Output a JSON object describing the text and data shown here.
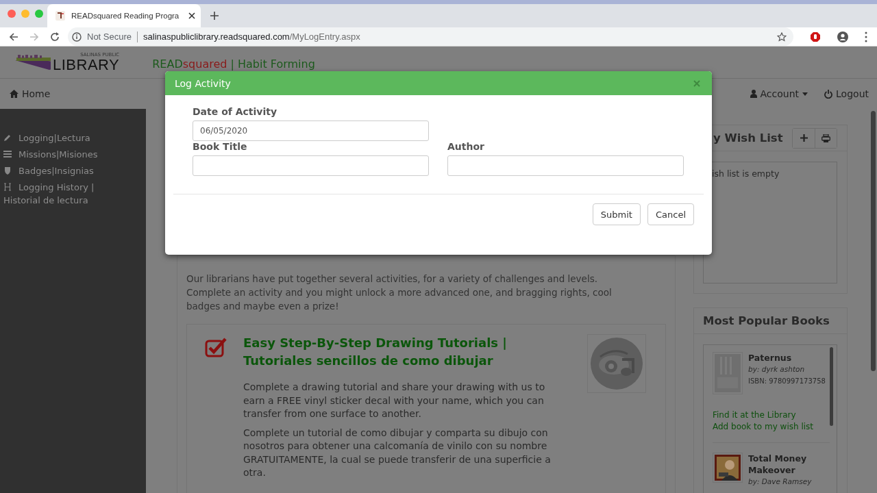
{
  "browser": {
    "tab_title": "READsquared Reading Progra",
    "security": "Not Secure",
    "url_host": "salinaspubliclibrary.readsquared.com",
    "url_path": "/MyLogEntry.aspx"
  },
  "header": {
    "logo_small": "SALINAS PUBLIC",
    "logo_big": "LIBRARY",
    "brand": [
      {
        "text": "READ",
        "color": "#1c5a1c"
      },
      {
        "text": "squared",
        "color": "#8a1a1a"
      },
      {
        "text": " | Habit Forming",
        "color": "#1c5a1c"
      }
    ]
  },
  "nav": {
    "home": "Home",
    "account": "Account",
    "logout": "Logout"
  },
  "sidebar": {
    "items": [
      {
        "label": "Logging|Lectura"
      },
      {
        "label": "Missions|Misiones"
      },
      {
        "label": "Badges|Insignias"
      },
      {
        "label": "Logging History | Historial de lectura"
      }
    ]
  },
  "main": {
    "intro": "Our librarians have put together several activities, for a variety of challenges and levels. Complete an activity and you might unlock a more advanced one, and bragging rights, cool badges and maybe even a prize!",
    "activity": {
      "completed": true,
      "title": "Easy Step-By-Step Drawing Tutorials | Tutoriales sencillos de como dibujar",
      "paragraphs": [
        "Complete a drawing tutorial and share your drawing with us to earn a FREE vinyl sticker decal with your name, which you can transfer from one surface to another.",
        "Complete un tutorial de como dibujar y comparta su dibujo con nosotros para obtener una calcomanía de vinilo con su nombre GRATUITAMENTE, la cual se puede transferir de una superficie a otra."
      ]
    }
  },
  "wish_list": {
    "title": "y Wish List",
    "empty_text": "ish list is empty"
  },
  "popular": {
    "title": "Most Popular Books",
    "books": [
      {
        "title": "Paternus",
        "author": "by: dyrk ashton",
        "isbn": "ISBN: 9780997173758",
        "links": [
          "Find it at the Library",
          "Add book to my wish list"
        ]
      },
      {
        "title": "Total Money Makeover",
        "author": "by: Dave Ramsey"
      }
    ]
  },
  "modal": {
    "title": "Log Activity",
    "fields": [
      {
        "label": "Date of Activity",
        "value": "06/05/2020"
      },
      {
        "label": "Book Title"
      },
      {
        "label": "Author"
      }
    ],
    "buttons": [
      "Submit",
      "Cancel"
    ]
  }
}
